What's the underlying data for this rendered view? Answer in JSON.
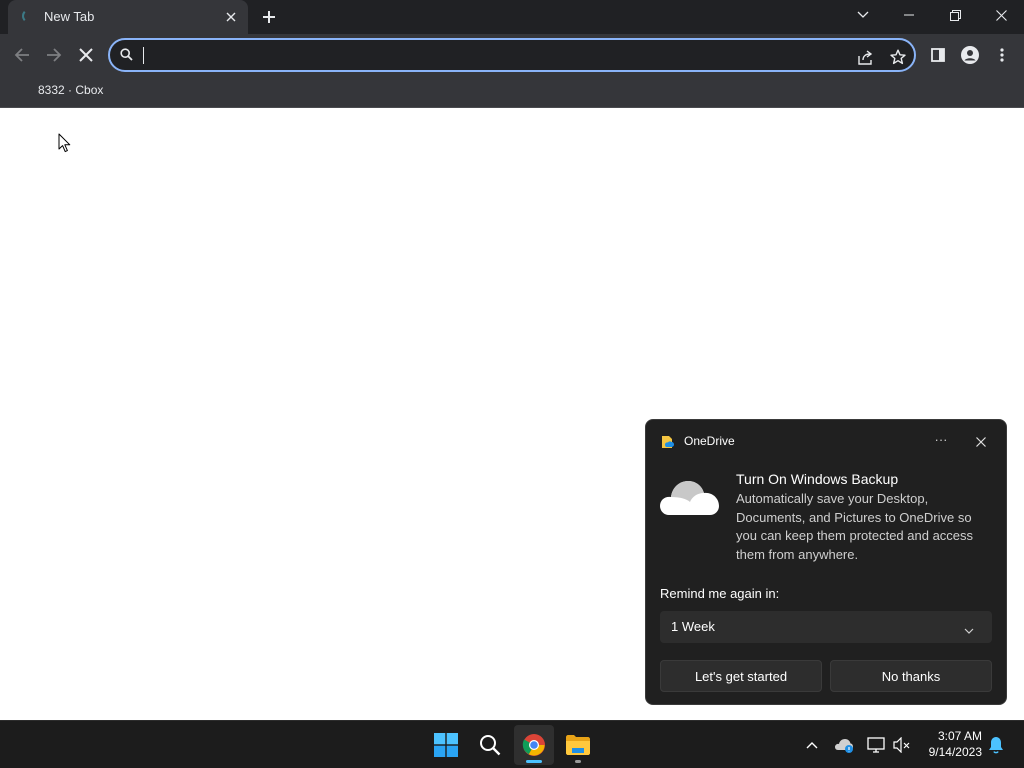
{
  "browser": {
    "tab": {
      "title": "New Tab"
    },
    "omnibox": {
      "value": "",
      "placeholder": ""
    },
    "bookmarks": [
      {
        "label": "8332 · Cbox"
      }
    ]
  },
  "toast": {
    "app_name": "OneDrive",
    "more_label": "···",
    "heading": "Turn On Windows Backup",
    "body": "Automatically save your Desktop, Documents, and Pictures to OneDrive so you can keep them protected and access them from anywhere.",
    "remind_label": "Remind me again in:",
    "remind_value": "1 Week",
    "primary_button": "Let's get started",
    "secondary_button": "No thanks"
  },
  "taskbar": {
    "apps": [
      {
        "name": "Start",
        "icon": "windows-logo-icon"
      },
      {
        "name": "Search",
        "icon": "search-icon"
      },
      {
        "name": "Google Chrome",
        "icon": "chrome-icon",
        "active": true
      },
      {
        "name": "File Explorer",
        "icon": "folder-icon"
      }
    ],
    "time": "3:07 AM",
    "date": "9/14/2023"
  },
  "colors": {
    "chrome_frame": "#202124",
    "chrome_toolbar": "#35363a",
    "omnibox_focus": "#8ab4f8",
    "toast_bg": "#202020",
    "taskbar_bg": "#1c1c1c",
    "accent_blue": "#4cc2ff"
  }
}
